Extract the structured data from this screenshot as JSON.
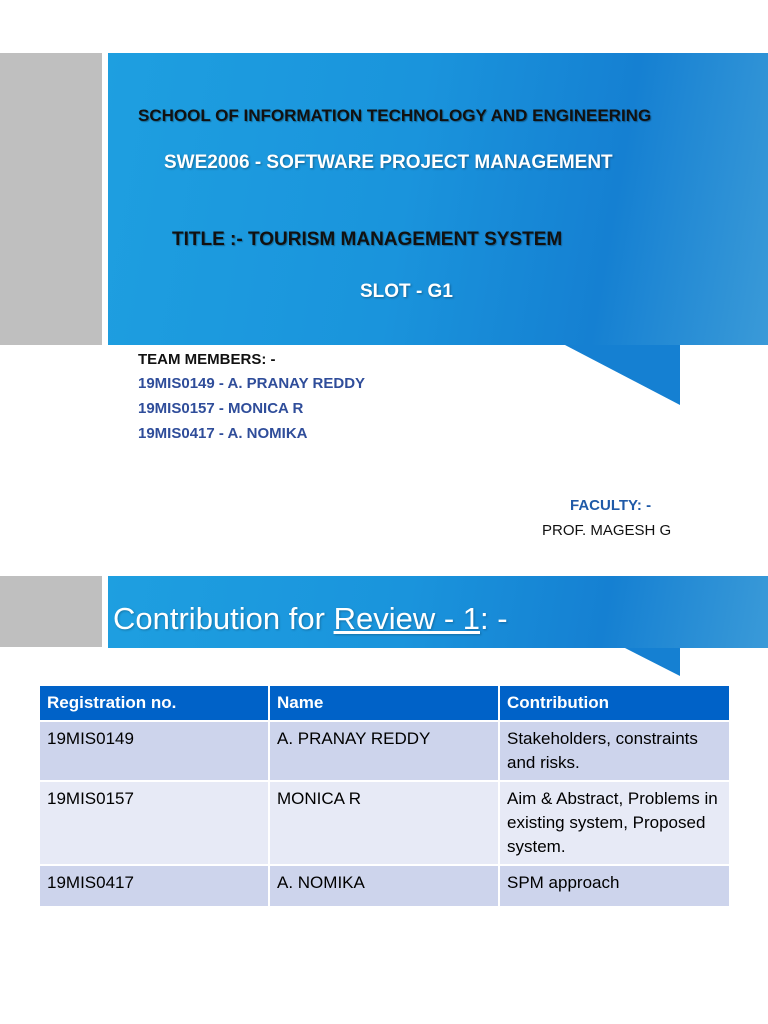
{
  "slide1": {
    "school": "SCHOOL OF INFORMATION TECHNOLOGY AND ENGINEERING",
    "course": "SWE2006 - SOFTWARE PROJECT MANAGEMENT",
    "title": "TITLE :- TOURISM MANAGEMENT SYSTEM",
    "slot": "SLOT - G1",
    "team_label": "TEAM MEMBERS: -",
    "members": [
      "19MIS0149 - A. PRANAY REDDY",
      "19MIS0157 - MONICA R",
      "19MIS0417 - A. NOMIKA"
    ],
    "faculty_label": "FACULTY: -",
    "faculty_name": "PROF. MAGESH G"
  },
  "slide2": {
    "heading_prefix": "Contribution for ",
    "heading_link": "Review - 1",
    "heading_suffix": ": -",
    "table": {
      "headers": [
        "Registration no.",
        "Name",
        "Contribution"
      ],
      "rows": [
        [
          "19MIS0149",
          "A. PRANAY REDDY",
          "Stakeholders, constraints and risks."
        ],
        [
          "19MIS0157",
          "MONICA R",
          "Aim & Abstract, Problems in existing system, Proposed system."
        ],
        [
          "19MIS0417",
          "A. NOMIKA",
          "SPM approach"
        ]
      ]
    }
  },
  "colors": {
    "banner": "#1a94dc",
    "header": "#0062c8",
    "member": "#2f4d9a",
    "faculty": "#1f5aa8"
  }
}
